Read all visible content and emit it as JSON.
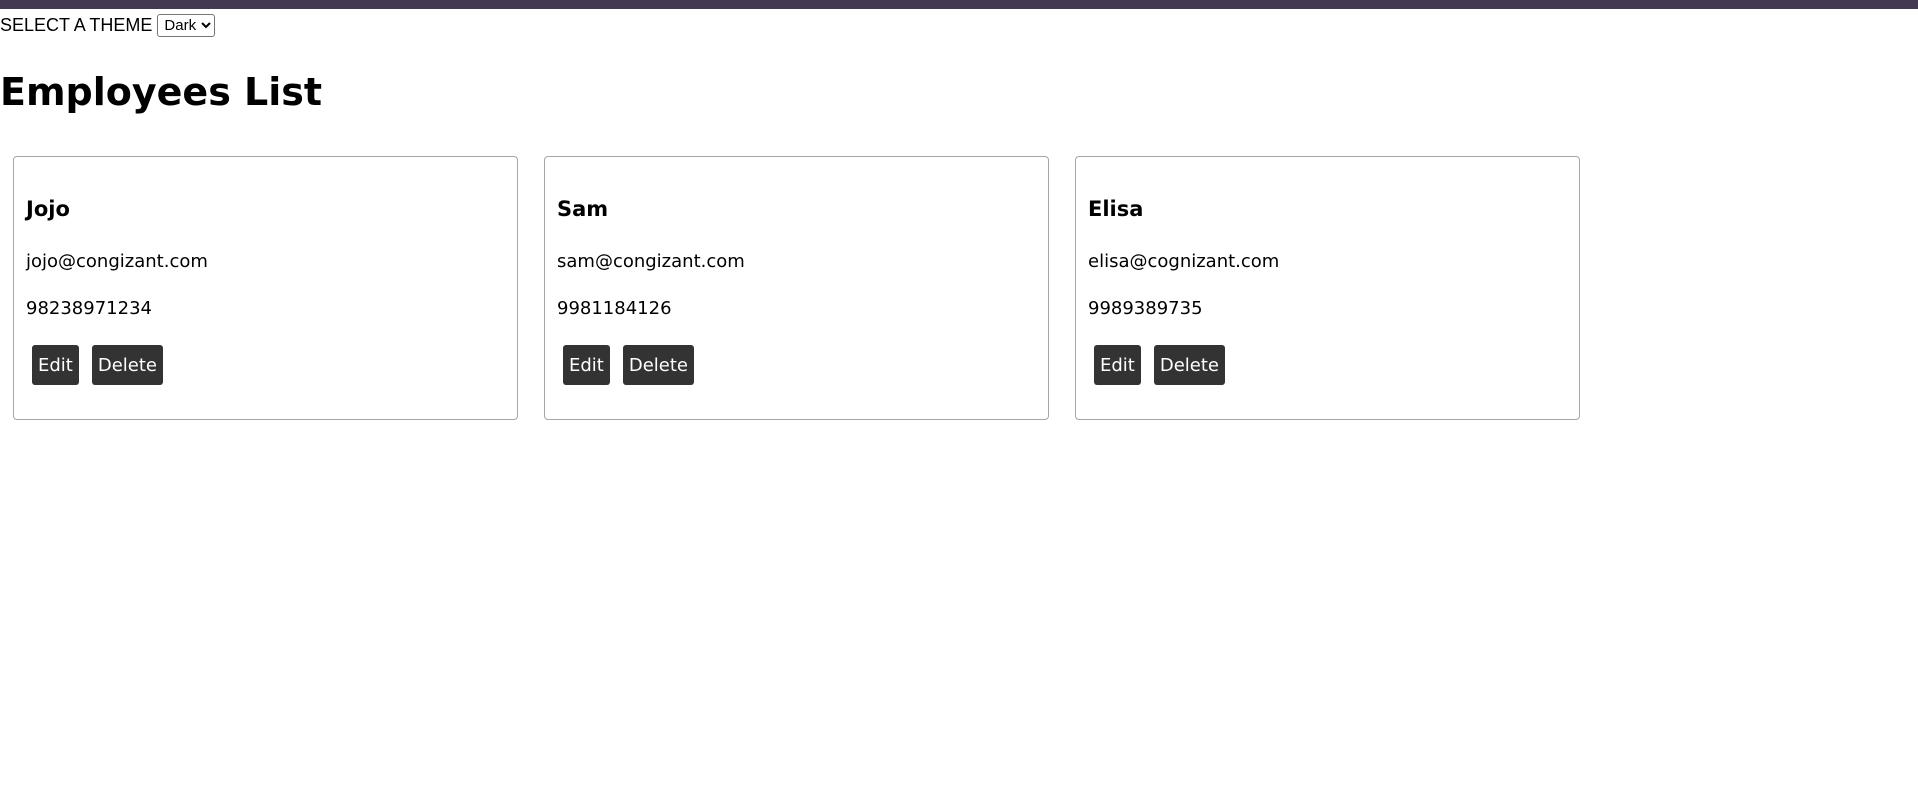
{
  "theme": {
    "label": "SELECT A THEME",
    "selected": "Dark",
    "options": [
      "Dark"
    ]
  },
  "page": {
    "title": "Employees List"
  },
  "employees": [
    {
      "name": "Jojo",
      "email": "jojo@congizant.com",
      "phone": "98238971234",
      "edit_label": "Edit",
      "delete_label": "Delete"
    },
    {
      "name": "Sam",
      "email": "sam@congizant.com",
      "phone": "9981184126",
      "edit_label": "Edit",
      "delete_label": "Delete"
    },
    {
      "name": "Elisa",
      "email": "elisa@cognizant.com",
      "phone": "9989389735",
      "edit_label": "Edit",
      "delete_label": "Delete"
    }
  ],
  "colors": {
    "top_bar": "#433a52",
    "button_bg": "#333333",
    "button_text": "#ffffff",
    "card_border": "#a6a6a6"
  }
}
